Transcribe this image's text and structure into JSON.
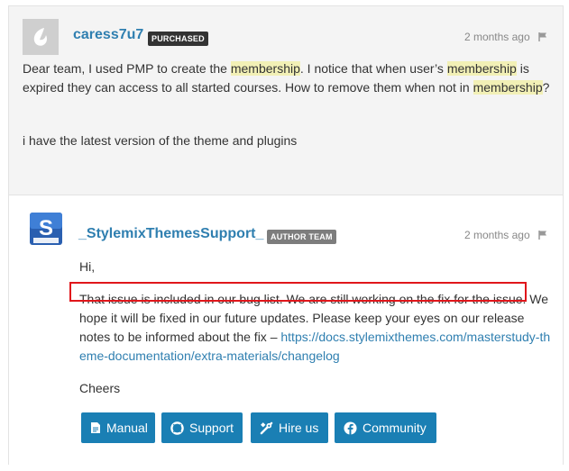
{
  "question": {
    "username": "caress7u7",
    "badge": "PURCHASED",
    "time": "2 months ago",
    "para1_a": "Dear team, I used PMP to create the ",
    "para1_hl1": "membership",
    "para1_b": ". I notice that when user’s ",
    "para1_hl2": "membership",
    "para1_c": " is expired they can access to all started courses. How to remove them when not in ",
    "para1_hl3": "membership",
    "para1_d": "?",
    "para2": "i have the latest version of the theme and plugins"
  },
  "answer": {
    "username": "_StylemixThemesSupport_",
    "badge": "AUTHOR TEAM",
    "time": "2 months ago",
    "greeting": "Hi,",
    "body_a": "That issue is included in our bug list. We are still working on the fix for the issue. We hope it will be fixed in our future updates. Please keep your eyes on our release notes to be informed about the fix – ",
    "link": "https://docs.stylemixthemes.com/masterstudy-theme-documentation/extra-materials/changelog",
    "signoff": "Cheers"
  },
  "buttons": [
    {
      "label": "Manual",
      "icon": "document-icon"
    },
    {
      "label": "Support",
      "icon": "lifebuoy-icon"
    },
    {
      "label": "Hire us",
      "icon": "tools-icon"
    },
    {
      "label": "Community",
      "icon": "facebook-icon"
    }
  ],
  "colors": {
    "accent": "#1a7fb4",
    "username": "#2f7fb0",
    "highlight": "#f2f0b6",
    "annotation_box": "#e0161b"
  }
}
